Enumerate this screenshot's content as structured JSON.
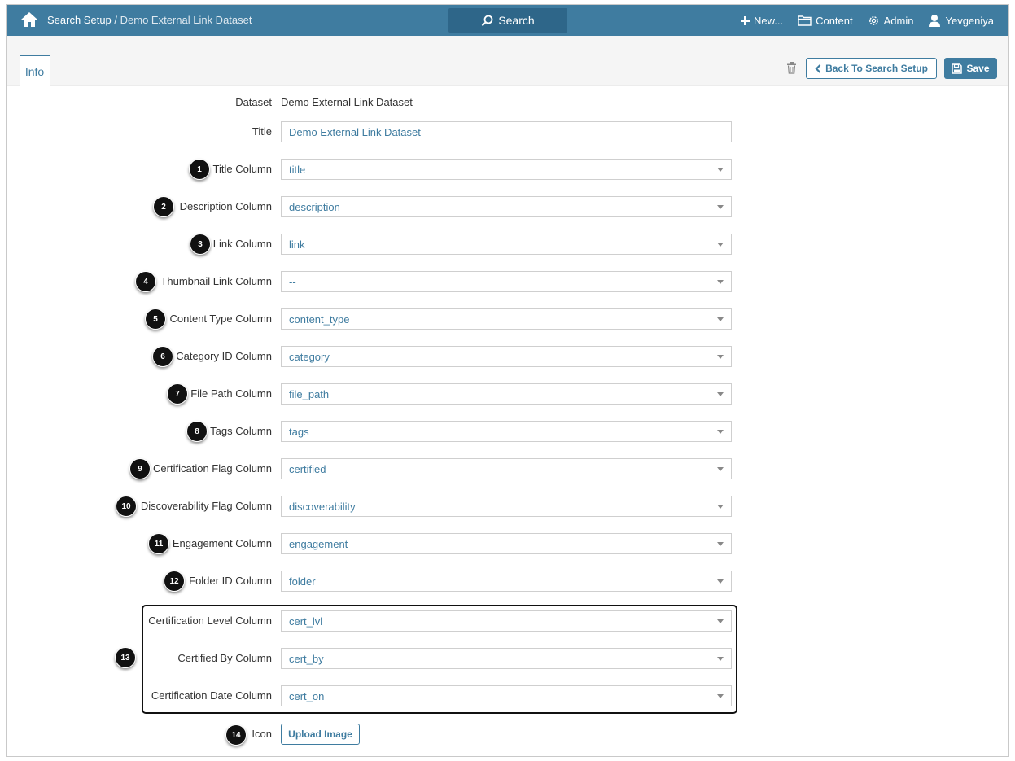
{
  "topbar": {
    "breadcrumb_root": "Search Setup",
    "breadcrumb_sep": " / ",
    "breadcrumb_current": "Demo External Link Dataset",
    "search_label": "Search",
    "new_label": "New...",
    "content_label": "Content",
    "admin_label": "Admin",
    "user_label": "Yevgeniya"
  },
  "subbar": {
    "tab_info": "Info",
    "back_label": "Back To Search Setup",
    "save_label": "Save"
  },
  "form": {
    "dataset_label": "Dataset",
    "dataset_value": "Demo External Link Dataset",
    "title_label": "Title",
    "title_value": "Demo External Link Dataset",
    "columns": [
      {
        "badge": "1",
        "label": "Title Column",
        "value": "title"
      },
      {
        "badge": "2",
        "label": "Description Column",
        "value": "description"
      },
      {
        "badge": "3",
        "label": "Link Column",
        "value": "link"
      },
      {
        "badge": "4",
        "label": "Thumbnail Link Column",
        "value": "--"
      },
      {
        "badge": "5",
        "label": "Content Type Column",
        "value": "content_type"
      },
      {
        "badge": "6",
        "label": "Category ID Column",
        "value": "category"
      },
      {
        "badge": "7",
        "label": "File Path Column",
        "value": "file_path"
      },
      {
        "badge": "8",
        "label": "Tags Column",
        "value": "tags"
      },
      {
        "badge": "9",
        "label": "Certification Flag Column",
        "value": "certified"
      },
      {
        "badge": "10",
        "label": "Discoverability Flag Column",
        "value": "discoverability"
      },
      {
        "badge": "11",
        "label": "Engagement Column",
        "value": "engagement"
      },
      {
        "badge": "12",
        "label": "Folder ID Column",
        "value": "folder"
      },
      {
        "badge": "",
        "label": "Certification Level Column",
        "value": "cert_lvl"
      },
      {
        "badge": "",
        "label": "Certified By Column",
        "value": "cert_by"
      },
      {
        "badge": "",
        "label": "Certification Date Column",
        "value": "cert_on"
      }
    ],
    "group_badge": "13",
    "icon_badge": "14",
    "icon_label": "Icon",
    "upload_label": "Upload Image"
  },
  "colors": {
    "accent": "#3f7ca0",
    "topbar": "#3f7ca0",
    "search_button": "#2e6689",
    "badge": "#111111"
  }
}
